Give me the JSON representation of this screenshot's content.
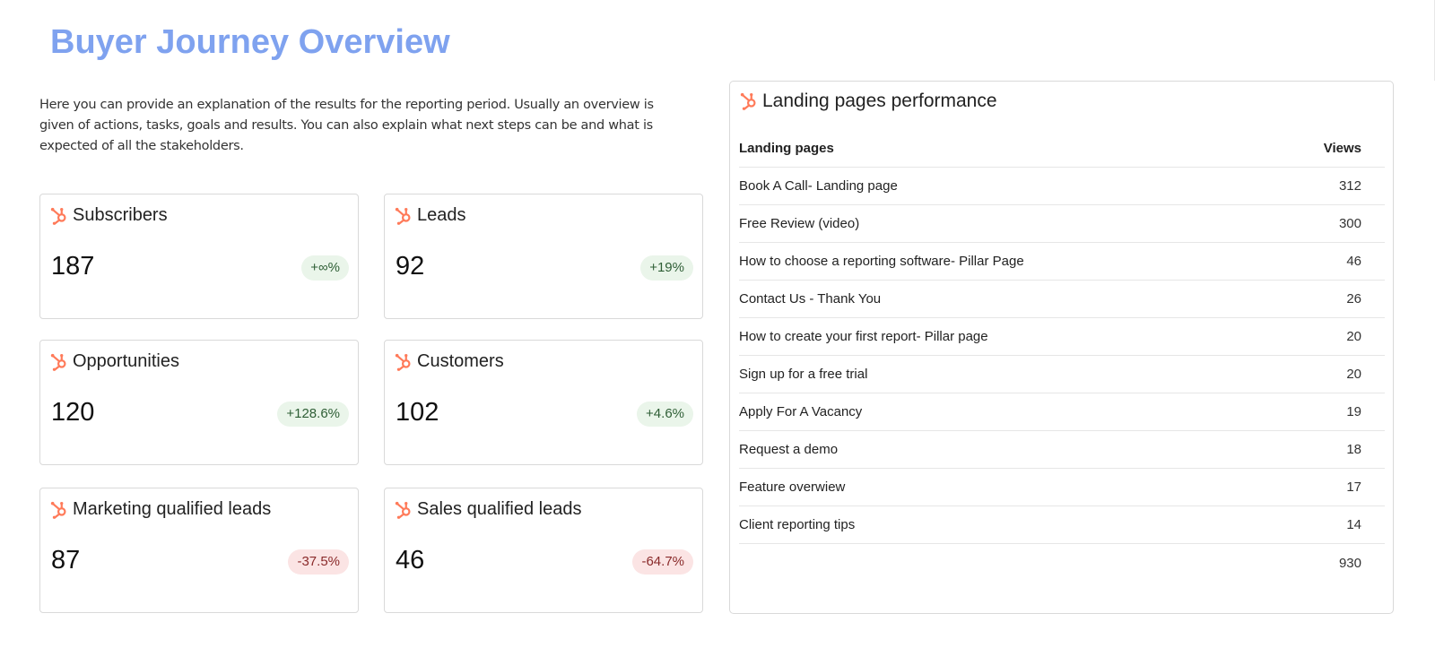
{
  "header": {
    "title": "Buyer Journey Overview",
    "intro": "Here you can provide an explanation of the results for the reporting period. Usually an overview is given of actions, tasks, goals and results. You can also explain what next steps can be and what is expected of all the stakeholders."
  },
  "colors": {
    "title": "#7fa2ef",
    "hubspot_icon": "#ff7a59",
    "positive_badge_bg": "#eaf5ea",
    "positive_badge_text": "#2e5e35",
    "negative_badge_bg": "#fbe4e4",
    "negative_badge_text": "#8a2a2a"
  },
  "cards": [
    {
      "title": "Subscribers",
      "value": "187",
      "change": "+∞%",
      "trend": "up",
      "icon": "hubspot-icon"
    },
    {
      "title": "Leads",
      "value": "92",
      "change": "+19%",
      "trend": "up",
      "icon": "hubspot-icon"
    },
    {
      "title": "Opportunities",
      "value": "120",
      "change": "+128.6%",
      "trend": "up",
      "icon": "hubspot-icon"
    },
    {
      "title": "Customers",
      "value": "102",
      "change": "+4.6%",
      "trend": "up",
      "icon": "hubspot-icon"
    },
    {
      "title": "Marketing qualified leads",
      "value": "87",
      "change": "-37.5%",
      "trend": "down",
      "icon": "hubspot-icon"
    },
    {
      "title": "Sales qualified leads",
      "value": "46",
      "change": "-64.7%",
      "trend": "down",
      "icon": "hubspot-icon"
    }
  ],
  "landing_pages": {
    "title": "Landing pages performance",
    "icon": "hubspot-icon",
    "columns": [
      "Landing pages",
      "Views"
    ],
    "rows": [
      {
        "page": "Book A Call- Landing page",
        "views": "312"
      },
      {
        "page": "Free Review (video)",
        "views": "300"
      },
      {
        "page": "How to choose a reporting software- Pillar Page",
        "views": "46"
      },
      {
        "page": "Contact Us - Thank You",
        "views": "26"
      },
      {
        "page": "How to create your first report- Pillar page",
        "views": "20"
      },
      {
        "page": "Sign up for a free trial",
        "views": "20"
      },
      {
        "page": "Apply For A Vacancy",
        "views": "19"
      },
      {
        "page": "Request a demo",
        "views": "18"
      },
      {
        "page": "Feature overwiew",
        "views": "17"
      },
      {
        "page": "Client reporting tips",
        "views": "14"
      }
    ],
    "total": "930"
  }
}
